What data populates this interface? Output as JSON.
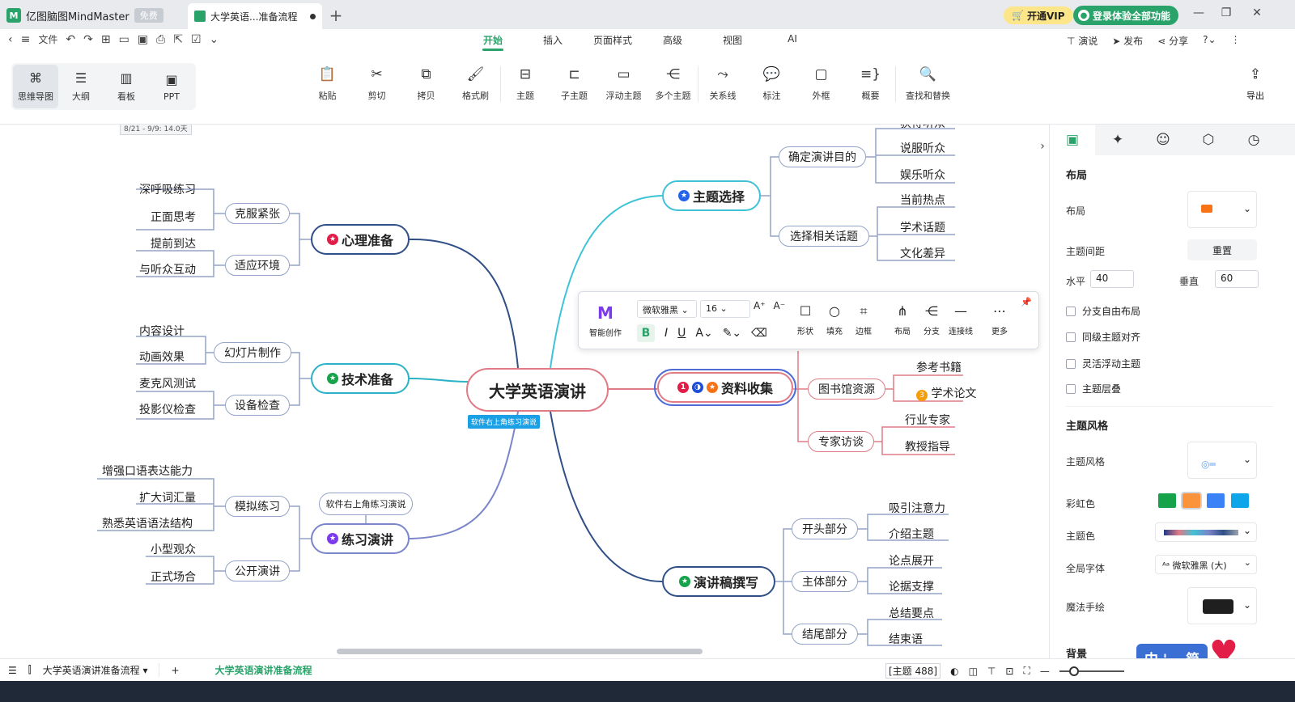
{
  "window": {
    "app_name": "亿图脑图MindMaster",
    "free_badge": "免费",
    "doc_tab": "大学英语...准备流程",
    "vip_label": "开通VIP",
    "login_label": "登录体验全部功能"
  },
  "menu": {
    "file": "文件",
    "tabs": [
      "开始",
      "插入",
      "页面样式",
      "高级",
      "视图",
      "AI"
    ],
    "active_tab": "开始",
    "right": [
      "演说",
      "发布",
      "分享"
    ]
  },
  "ribbon": {
    "views": [
      "思维导图",
      "大纲",
      "看板",
      "PPT"
    ],
    "tools": [
      "粘贴",
      "剪切",
      "拷贝",
      "格式刷",
      "主题",
      "子主题",
      "浮动主题",
      "多个主题",
      "关系线",
      "标注",
      "外框",
      "概要",
      "查找和替换"
    ],
    "export": "导出"
  },
  "mindmap": {
    "center": "大学英语演讲",
    "center_label": "软件右上角练习演说",
    "date_chip": "8/21 - 9/9: 14.0天",
    "callout": "软件右上角练习演说",
    "left": [
      {
        "title": "心理准备",
        "subs": [
          {
            "title": "克服紧张",
            "leaves": [
              "深呼吸练习",
              "正面思考"
            ]
          },
          {
            "title": "适应环境",
            "leaves": [
              "提前到达",
              "与听众互动"
            ]
          }
        ]
      },
      {
        "title": "技术准备",
        "subs": [
          {
            "title": "幻灯片制作",
            "leaves": [
              "内容设计",
              "动画效果"
            ]
          },
          {
            "title": "设备检查",
            "leaves": [
              "麦克风测试",
              "投影仪检查"
            ]
          }
        ]
      },
      {
        "title": "练习演讲",
        "subs": [
          {
            "title": "模拟练习",
            "leaves": [
              "增强口语表达能力",
              "扩大词汇量",
              "熟悉英语语法结构"
            ]
          },
          {
            "title": "公开演讲",
            "leaves": [
              "小型观众",
              "正式场合"
            ]
          }
        ]
      }
    ],
    "right": [
      {
        "title": "主题选择",
        "subs": [
          {
            "title": "确定演讲目的",
            "leaves": [
              "获得听众",
              "说服听众",
              "娱乐听众"
            ]
          },
          {
            "title": "选择相关话题",
            "leaves": [
              "当前热点",
              "学术话题",
              "文化差异"
            ]
          }
        ]
      },
      {
        "title": "资料收集",
        "subs": [
          {
            "title": "图书馆资源",
            "leaves": [
              "参考书籍",
              "学术论文"
            ]
          },
          {
            "title": "专家访谈",
            "leaves": [
              "行业专家",
              "教授指导"
            ]
          }
        ]
      },
      {
        "title": "演讲稿撰写",
        "subs": [
          {
            "title": "开头部分",
            "leaves": [
              "吸引注意力",
              "介绍主题"
            ]
          },
          {
            "title": "主体部分",
            "leaves": [
              "论点展开",
              "论据支撑"
            ]
          },
          {
            "title": "结尾部分",
            "leaves": [
              "总结要点",
              "结束语"
            ]
          }
        ]
      }
    ]
  },
  "floating_toolbar": {
    "ai": "智能创作",
    "font": "微软雅黑",
    "size": "16",
    "tools": [
      "形状",
      "填充",
      "边框",
      "布局",
      "分支",
      "连接线",
      "更多"
    ]
  },
  "panel": {
    "layout_heading": "布局",
    "layout_label": "布局",
    "spacing_label": "主题间距",
    "reset": "重置",
    "horizontal_label": "水平",
    "horizontal_value": "40",
    "vertical_label": "垂直",
    "vertical_value": "60",
    "checks": [
      "分支自由布局",
      "同级主题对齐",
      "灵活浮动主题",
      "主题层叠"
    ],
    "style_heading": "主题风格",
    "style_label": "主题风格",
    "rainbow_label": "彩虹色",
    "theme_color_label": "主题色",
    "font_label": "全局字体",
    "font_value": "微软雅黑 (大)",
    "magic_label": "魔法手绘",
    "bg_heading": "背景"
  },
  "status": {
    "sheet": "大学英语演讲准备流程",
    "active_sheet": "大学英语演讲准备流程",
    "topic_count": "[主题 488]"
  },
  "ime": "中 ' 。简",
  "colors": {
    "accent": "#2aa36b",
    "center_border": "#e07b86",
    "left_branch": "#2f4f86",
    "right_teal": "#3ec3d6"
  }
}
